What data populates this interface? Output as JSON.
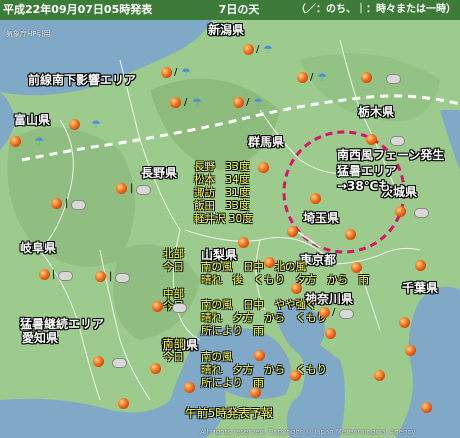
{
  "header": {
    "issued": "平成22年09月07日05時発表",
    "day": "7日の天気",
    "legend": "（／：のち、｜：時々または一時）"
  },
  "credits": {
    "source": "気象庁HP引用"
  },
  "prefectures": {
    "niigata": "新潟県",
    "toyama": "富山県",
    "gunma": "群馬県",
    "tochigi": "栃木県",
    "nagano": "長野県",
    "ibaraki": "茨城県",
    "saitama": "埼玉県",
    "gifu": "岐阜県",
    "yamanashi": "山梨県",
    "tokyo": "東京都",
    "kanagawa": "神奈川県",
    "chiba": "千葉県",
    "aichi": "愛知県",
    "shizuoka": "静岡県"
  },
  "notes": {
    "front_south": "前線南下影響エリア",
    "heat_continues": "猛暑継続エリア",
    "foehn_1": "南西風フェーン発生",
    "foehn_2": "猛暑エリア",
    "foehn_3": "→38℃も"
  },
  "temps": [
    "長野　33度",
    "松本　34度",
    "諏訪　31度",
    "飯田　33度",
    "軽井沢 30度"
  ],
  "forecast": {
    "north": {
      "region": "北部",
      "day": "今日",
      "wind": "南の風　日中　北の風",
      "weather": "晴れ　後　くもり　夕方　から　雨"
    },
    "central": {
      "region": "中部",
      "day": "今日",
      "wind": "南の風　日中　やや強く",
      "weather": "晴れ　夕方　から　くもり",
      "weather2": "所により　雨"
    },
    "south": {
      "region": "南部",
      "day": "今日",
      "wind": "南の風",
      "weather": "晴れ　夕方　から　くもり",
      "weather2": "所により　雨"
    }
  },
  "footer": {
    "issued": "午前5時発表予報",
    "copyright": "All rights reserved. Copyright © Japan Meteorological Agency"
  }
}
